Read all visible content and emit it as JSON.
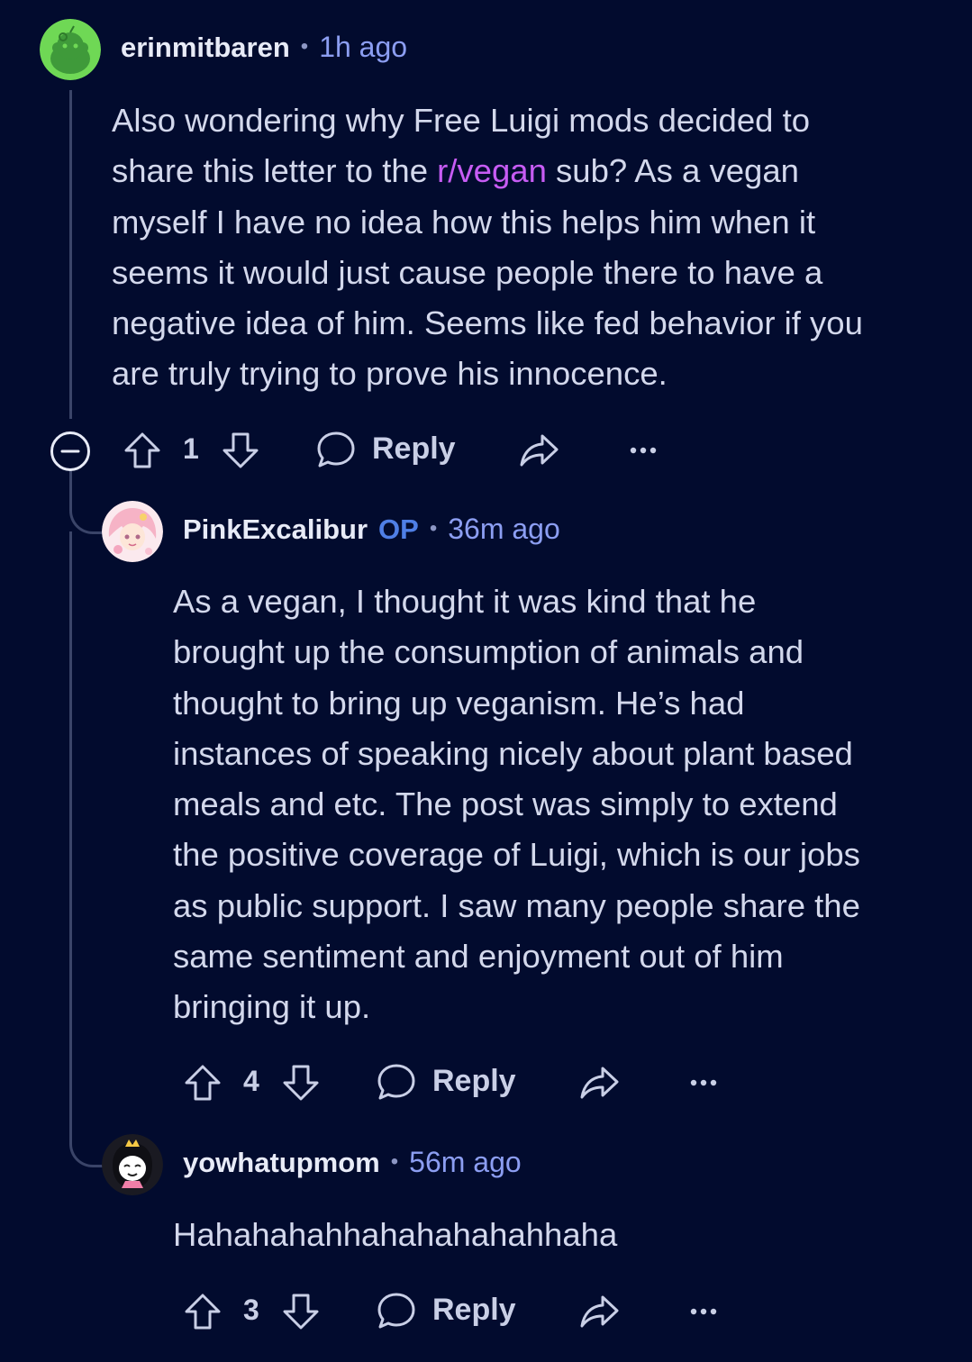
{
  "comments": [
    {
      "username": "erinmitbaren",
      "time": "1h ago",
      "body_lines": [
        "Also wondering why Free Luigi mods decided to",
        "share this letter to the ",
        "myself I have no idea how this helps him when it",
        "seems it would just cause people there to have a",
        "negative idea of him. Seems like fed behavior if you",
        "are truly trying to prove his innocence."
      ],
      "subreddit_link": "r/vegan",
      "line2_tail": " sub? As a vegan",
      "votes": "1",
      "reply_label": "Reply",
      "avatar_icon": "snoo-avatar-green"
    },
    {
      "username": "PinkExcalibur",
      "op_badge": "OP",
      "time": "36m ago",
      "body_lines": [
        "As a vegan, I thought it was kind that he",
        "brought up the consumption of animals and",
        "thought to bring up veganism. He’s had",
        "instances of speaking nicely about plant based",
        "meals and etc. The post was simply to extend",
        "the positive coverage of Luigi, which is our jobs",
        "as public support. I saw many people share the",
        "same sentiment and enjoyment out of him",
        "bringing it up."
      ],
      "votes": "4",
      "reply_label": "Reply",
      "avatar_icon": "anime-avatar-pink"
    },
    {
      "username": "yowhatupmom",
      "time": "56m ago",
      "body_lines": [
        "Hahahahahhahahahahahhaha"
      ],
      "votes": "3",
      "reply_label": "Reply",
      "avatar_icon": "cartoon-avatar-princess"
    }
  ],
  "separator": "•",
  "colors": {
    "background": "#020b2e",
    "text": "#d3d8ec",
    "time": "#8c9ef2",
    "op": "#4f7fe6",
    "link": "#c75cf4",
    "thread_line": "#3a4468"
  }
}
